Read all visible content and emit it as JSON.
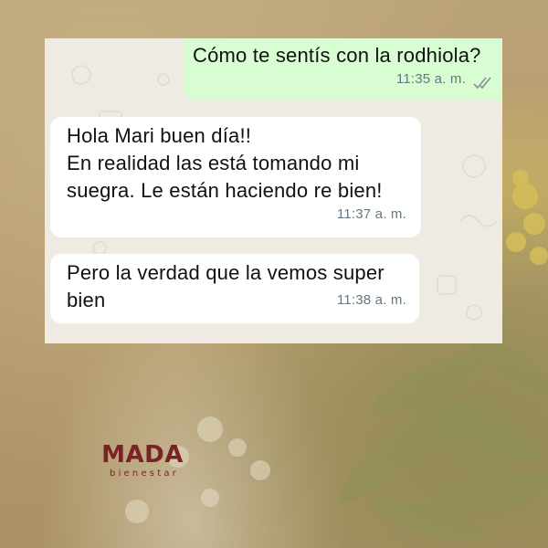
{
  "chat": {
    "messages": [
      {
        "direction": "outgoing",
        "text": "Cómo te sentís con la rodhiola?",
        "time": "11:35 a. m.",
        "status_icon": "double-check-icon"
      },
      {
        "direction": "incoming",
        "text": "Hola Mari buen día!!\nEn realidad las está tomando mi\nsuegra. Le están haciendo re bien!",
        "time": "11:37 a. m."
      },
      {
        "direction": "incoming",
        "text": "Pero la verdad que la vemos super\nbien",
        "time": "11:38 a. m."
      }
    ]
  },
  "brand": {
    "name": "MADA",
    "tagline": "bienestar",
    "color": "#7a2327"
  },
  "colors": {
    "outgoing_bubble": "#d9fdd3",
    "incoming_bubble": "#ffffff",
    "chat_background": "#efeae2",
    "timestamp": "#667781"
  }
}
